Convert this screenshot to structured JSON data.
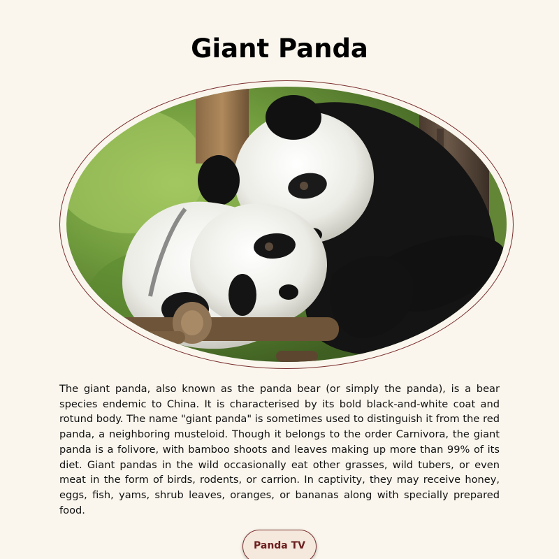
{
  "page": {
    "title": "Giant Panda",
    "description": "The giant panda, also known as the panda bear (or simply the panda), is a bear species endemic to China. It is characterised by its bold black-and-white coat and rotund body. The name \"giant panda\" is sometimes used to distinguish it from the red panda, a neighboring musteloid. Though it belongs to the order Carnivora, the giant panda is a folivore, with bamboo shoots and leaves making up more than 99% of its diet. Giant pandas in the wild occasionally eat other grasses, wild tubers, or even meat in the form of birds, rodents, or carrion. In captivity, they may receive honey, eggs, fish, yams, shrub leaves, oranges, or bananas along with specially prepared food.",
    "button_label": "Panda TV"
  },
  "colors": {
    "background": "#faf6ed",
    "accent": "#7a2e2e",
    "button_background": "#f5e8dc",
    "button_text": "#6b1e1e"
  }
}
